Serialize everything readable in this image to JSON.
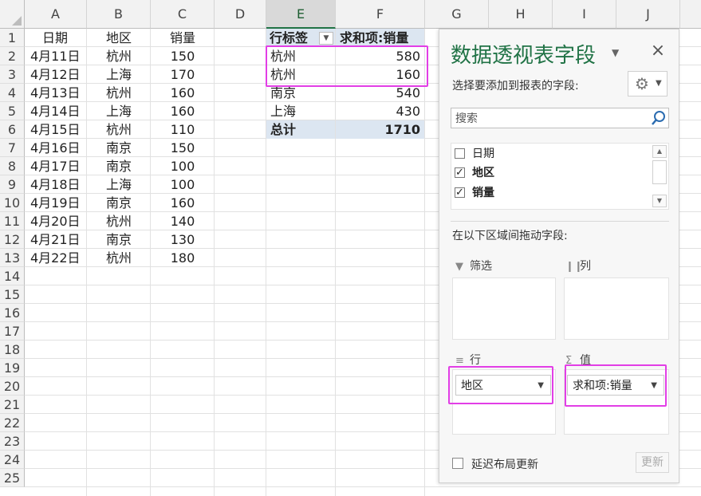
{
  "columns": [
    "A",
    "B",
    "C",
    "D",
    "E",
    "F",
    "G",
    "H",
    "I",
    "J"
  ],
  "rows": [
    "1",
    "2",
    "3",
    "4",
    "5",
    "6",
    "7",
    "8",
    "9",
    "10",
    "11",
    "12",
    "13",
    "14",
    "15",
    "16",
    "17",
    "18",
    "19",
    "20",
    "21",
    "22",
    "23",
    "24",
    "25"
  ],
  "table": {
    "headers": [
      "日期",
      "地区",
      "销量"
    ],
    "rows": [
      [
        "4月11日",
        "杭州",
        "150"
      ],
      [
        "4月12日",
        "上海",
        "170"
      ],
      [
        "4月13日",
        "杭州",
        "160"
      ],
      [
        "4月14日",
        "上海",
        "160"
      ],
      [
        "4月15日",
        "杭州",
        "110"
      ],
      [
        "4月16日",
        "南京",
        "150"
      ],
      [
        "4月17日",
        "南京",
        "100"
      ],
      [
        "4月18日",
        "上海",
        "100"
      ],
      [
        "4月19日",
        "南京",
        "160"
      ],
      [
        "4月20日",
        "杭州",
        "140"
      ],
      [
        "4月21日",
        "南京",
        "130"
      ],
      [
        "4月22日",
        "杭州",
        "180"
      ]
    ]
  },
  "pivot": {
    "row_label_header": "行标签",
    "value_header": "求和项:销量",
    "rows": [
      [
        "杭州",
        "580"
      ],
      [
        "杭州",
        "160"
      ],
      [
        "南京",
        "540"
      ],
      [
        "上海",
        "430"
      ]
    ],
    "total_label": "总计",
    "total_value": "1710"
  },
  "pane": {
    "title": "数据透视表字段",
    "close": "×",
    "subtitle": "选择要添加到报表的字段:",
    "search_placeholder": "搜索",
    "fields": [
      {
        "label": "日期",
        "checked": false
      },
      {
        "label": "地区",
        "checked": true
      },
      {
        "label": "销量",
        "checked": true
      }
    ],
    "drag_label": "在以下区域间拖动字段:",
    "areas": {
      "filter": "筛选",
      "columns": "列",
      "rows": "行",
      "values": "值"
    },
    "row_field": "地区",
    "value_field": "求和项:销量",
    "defer_label": "延迟布局更新",
    "update_button": "更新"
  },
  "colors": {
    "highlight": "#e23ee6",
    "accent": "#217346",
    "pivot_band": "#dce6f1"
  }
}
